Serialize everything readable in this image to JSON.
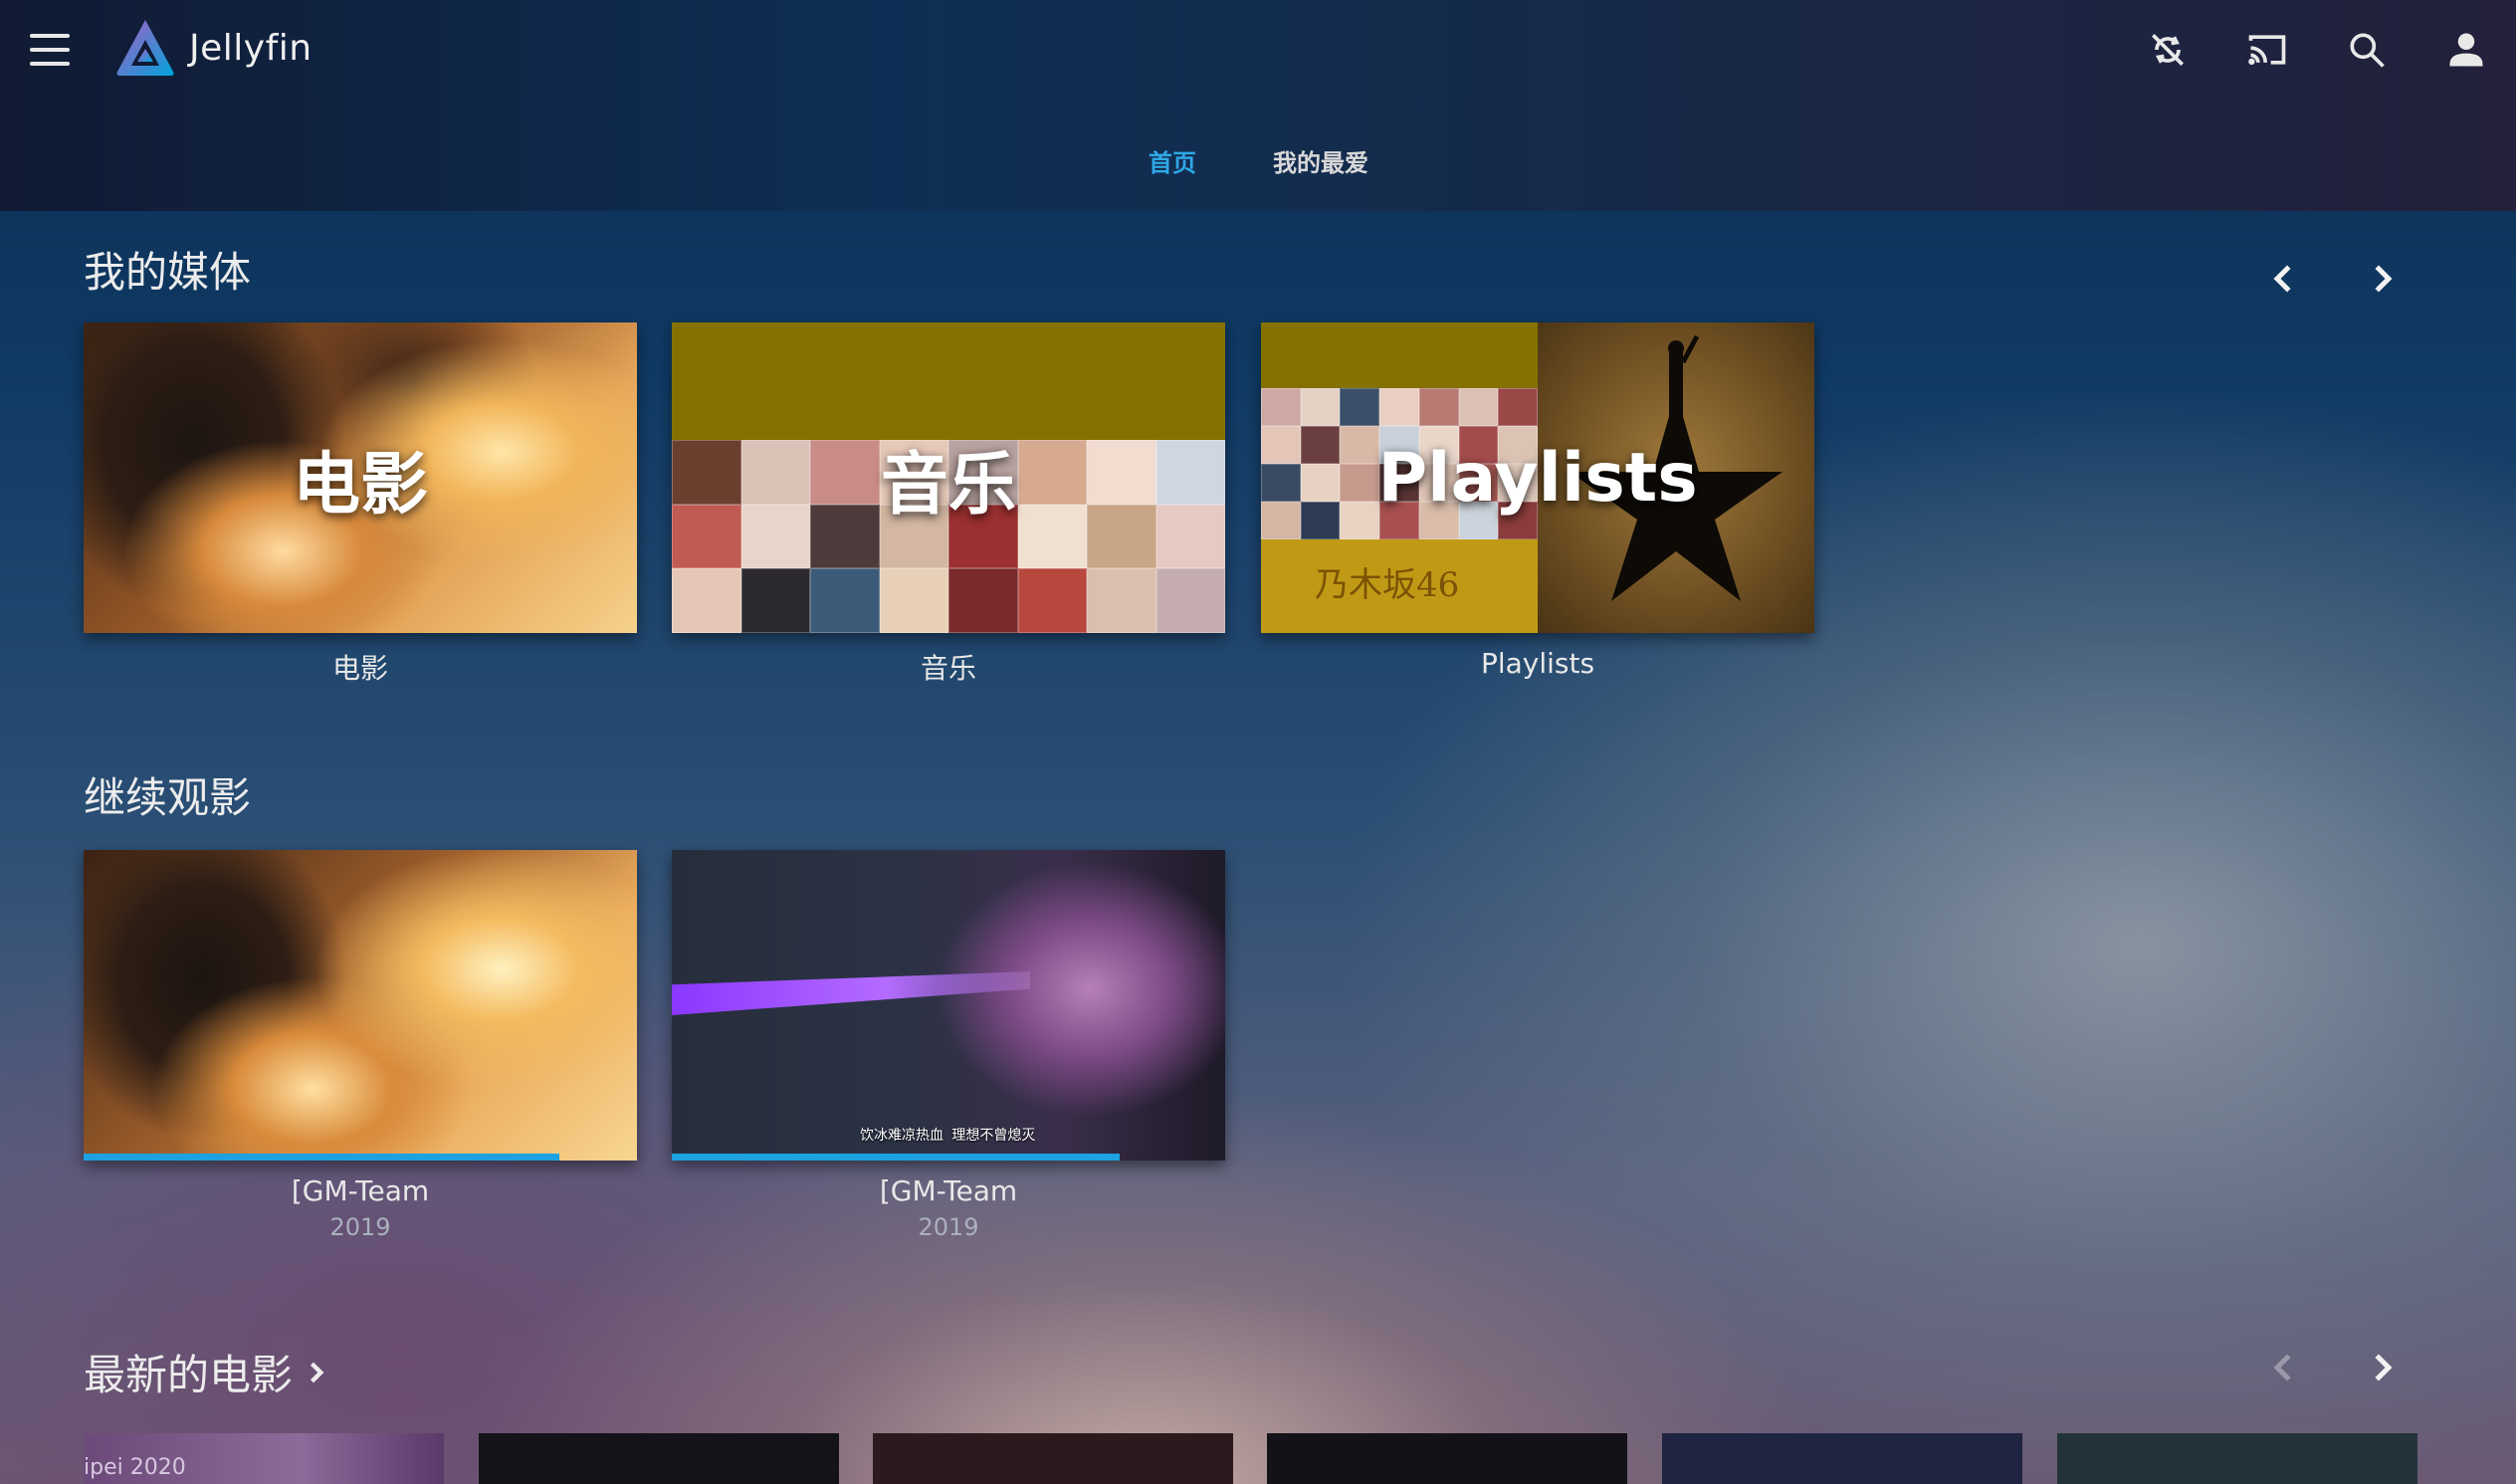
{
  "app": {
    "name": "Jellyfin"
  },
  "header": {
    "tabs": [
      {
        "label": "首页",
        "active": true
      },
      {
        "label": "我的最爱",
        "active": false
      }
    ],
    "icons": [
      "sync-disabled-icon",
      "cast-icon",
      "search-icon",
      "user-icon"
    ]
  },
  "my_media": {
    "title": "我的媒体",
    "items": [
      {
        "overlay": "电影",
        "label": "电影"
      },
      {
        "overlay": "音乐",
        "label": "音乐"
      },
      {
        "overlay": "Playlists",
        "label": "Playlists",
        "band_text": "乃木坂46"
      }
    ]
  },
  "continue_watching": {
    "title": "继续观影",
    "items": [
      {
        "label": "[GM-Team",
        "year": "2019",
        "progress": 0.86
      },
      {
        "label": "[GM-Team",
        "year": "2019",
        "progress": 0.81,
        "subtitle": "饮冰难凉热血 理想不曾熄灭"
      }
    ]
  },
  "latest_movies": {
    "title": "最新的电影",
    "first_card_text": "ipei 2020"
  },
  "colors": {
    "accent": "#2fa8e6",
    "progress": "#1ea1e0"
  }
}
